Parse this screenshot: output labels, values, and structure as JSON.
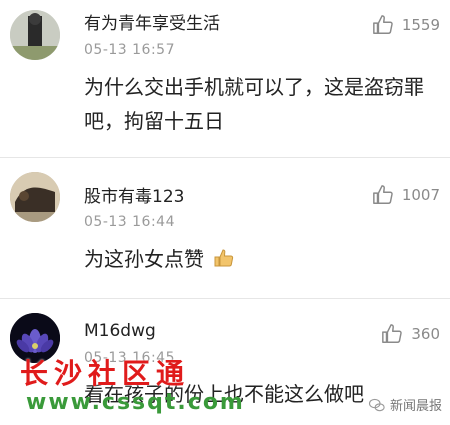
{
  "comments": [
    {
      "username": "有为青年享受生活",
      "timestamp": "05-13  16:57",
      "text": "为什么交出手机就可以了，这是盗窃罪吧，拘留十五日",
      "likes": "1559",
      "avatar_icon": "user-avatar-photo"
    },
    {
      "username": "股市有毒123",
      "timestamp": "05-13  16:44",
      "text": "为这孙女点赞",
      "likes": "1007",
      "avatar_icon": "user-avatar-photo"
    },
    {
      "username": "M16dwg",
      "timestamp": "05-13  16:45",
      "text": "看在孩子的份上也不能这么做吧",
      "likes": "360",
      "avatar_icon": "lotus-avatar"
    }
  ],
  "watermark": {
    "title": "长沙社区通",
    "url": "www.cssqt.com",
    "color": "#e01b1b"
  },
  "source_badge": "新闻晨报",
  "colors": {
    "text": "#222222",
    "meta": "#9a9a9a",
    "divider": "#e6e6e6"
  }
}
